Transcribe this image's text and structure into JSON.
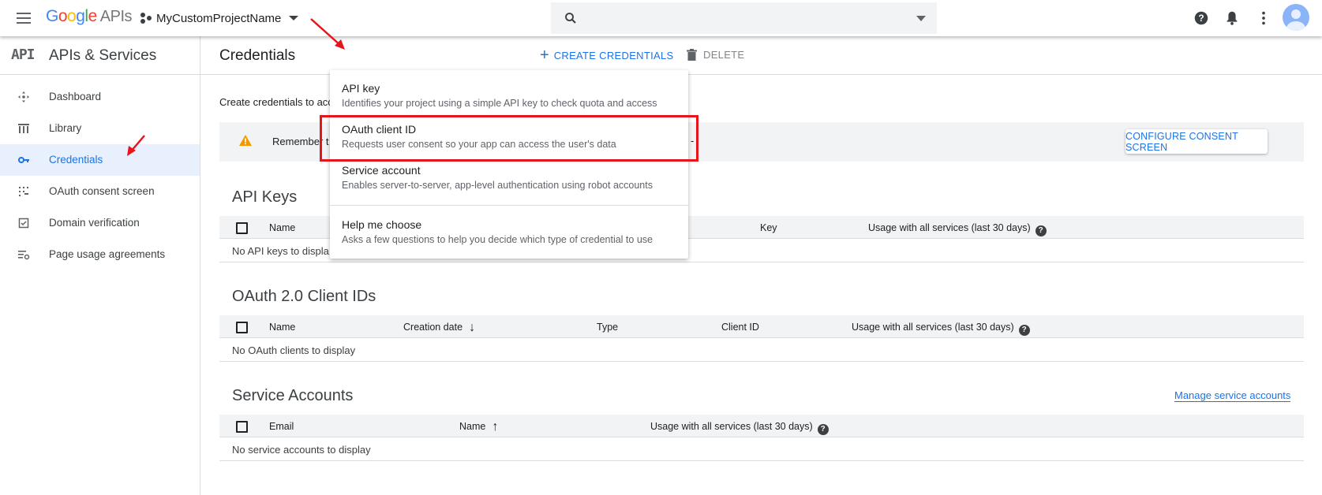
{
  "topbar": {
    "logo_google": "Google",
    "logo_apis": "APIs",
    "project_name": "MyCustomProjectName",
    "search_placeholder": ""
  },
  "icons": {
    "menu": "menu-icon",
    "project": "project-dots-icon",
    "search": "search-icon",
    "help": "help-icon",
    "notifications": "bell-icon",
    "more": "more-vert-icon",
    "account": "avatar-icon"
  },
  "sidebar": {
    "logo_text": "API",
    "title": "APIs & Services",
    "items": [
      {
        "label": "Dashboard",
        "icon": "dashboard-icon"
      },
      {
        "label": "Library",
        "icon": "library-icon"
      },
      {
        "label": "Credentials",
        "icon": "key-icon",
        "active": true
      },
      {
        "label": "OAuth consent screen",
        "icon": "consent-icon"
      },
      {
        "label": "Domain verification",
        "icon": "checkbox-icon"
      },
      {
        "label": "Page usage agreements",
        "icon": "settings-list-icon"
      }
    ]
  },
  "header": {
    "title": "Credentials",
    "create_label": "CREATE CREDENTIALS",
    "delete_label": "DELETE"
  },
  "intro_text": "Create credentials to acc",
  "notice": {
    "text": "Remember t",
    "dash": "-",
    "button_label": "CONFIGURE CONSENT SCREEN"
  },
  "dropdown": {
    "items": [
      {
        "title": "API key",
        "desc": "Identifies your project using a simple API key to check quota and access"
      },
      {
        "title": "OAuth client ID",
        "desc": "Requests user consent so your app can access the user's data"
      },
      {
        "title": "Service account",
        "desc": "Enables server-to-server, app-level authentication using robot accounts"
      },
      {
        "title": "Help me choose",
        "desc": "Asks a few questions to help you decide which type of credential to use"
      }
    ]
  },
  "api_keys": {
    "title": "API Keys",
    "columns": [
      "Name",
      "Key",
      "Usage with all services (last 30 days)"
    ],
    "empty": "No API keys to displa"
  },
  "oauth": {
    "title": "OAuth 2.0 Client IDs",
    "columns": [
      "Name",
      "Creation date",
      "Type",
      "Client ID",
      "Usage with all services (last 30 days)"
    ],
    "empty": "No OAuth clients to display"
  },
  "service_accounts": {
    "title": "Service Accounts",
    "manage_link": "Manage service accounts",
    "columns": [
      "Email",
      "Name",
      "Usage with all services (last 30 days)"
    ],
    "empty": "No service accounts to display"
  },
  "help_glyph": "?",
  "colors": {
    "accent": "#1a73e8",
    "annotation_red": "#e8141b",
    "active_bg": "#e8f0fe",
    "header_gray": "#f1f3f4"
  }
}
